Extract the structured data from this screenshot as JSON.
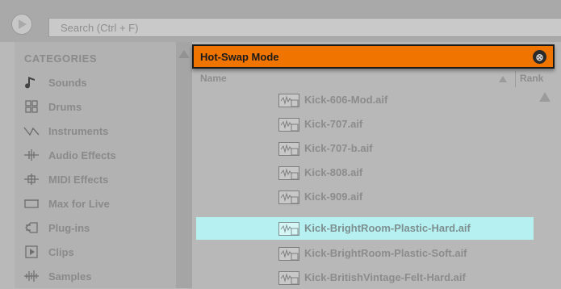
{
  "search": {
    "placeholder": "Search (Ctrl + F)"
  },
  "categories": {
    "header": "CATEGORIES",
    "items": [
      {
        "label": "Sounds",
        "icon": "music-note-icon"
      },
      {
        "label": "Drums",
        "icon": "drum-pads-icon"
      },
      {
        "label": "Instruments",
        "icon": "waveform-icon"
      },
      {
        "label": "Audio Effects",
        "icon": "audio-effects-icon"
      },
      {
        "label": "MIDI Effects",
        "icon": "midi-effects-icon"
      },
      {
        "label": "Max for Live",
        "icon": "max-for-live-icon"
      },
      {
        "label": "Plug-ins",
        "icon": "plugin-icon"
      },
      {
        "label": "Clips",
        "icon": "clip-icon"
      },
      {
        "label": "Samples",
        "icon": "samples-icon"
      }
    ]
  },
  "browser": {
    "col_name": "Name",
    "col_rank": "Rank",
    "files": [
      {
        "name": "Kick-606-Mod.aif",
        "selected": false
      },
      {
        "name": "Kick-707.aif",
        "selected": false
      },
      {
        "name": "Kick-707-b.aif",
        "selected": false
      },
      {
        "name": "Kick-808.aif",
        "selected": false
      },
      {
        "name": "Kick-909.aif",
        "selected": false
      },
      {
        "name": "Kick-BrightRoom-Plastic-Hard.aif",
        "selected": true
      },
      {
        "name": "Kick-BrightRoom-Plastic-Soft.aif",
        "selected": false
      },
      {
        "name": "Kick-BritishVintage-Felt-Hard.aif",
        "selected": false
      }
    ]
  },
  "hotswap": {
    "title": "Hot-Swap Mode",
    "close_symbol": "⊗"
  },
  "colors": {
    "hotswap_bg": "#ef7400",
    "selection": "#b6f0f1"
  }
}
